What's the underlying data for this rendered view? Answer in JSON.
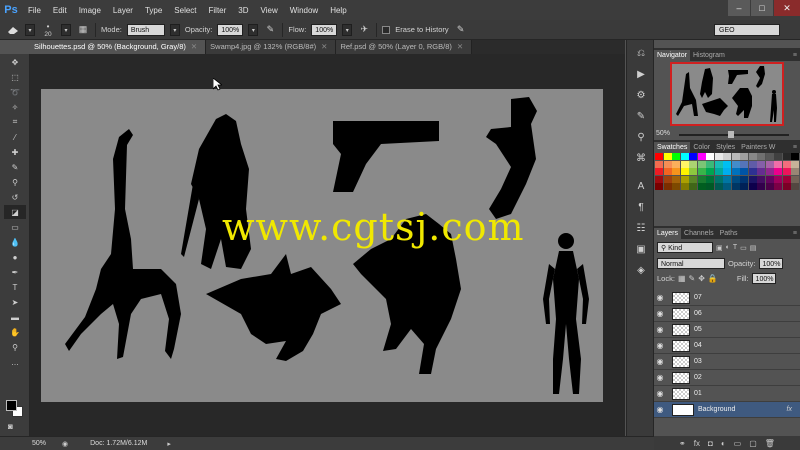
{
  "app": {
    "logo": "Ps"
  },
  "menu": [
    "File",
    "Edit",
    "Image",
    "Layer",
    "Type",
    "Select",
    "Filter",
    "3D",
    "View",
    "Window",
    "Help"
  ],
  "window_controls": [
    "–",
    "□",
    "✕"
  ],
  "options": {
    "brush_size": "20",
    "mode_label": "Mode:",
    "mode_value": "Brush",
    "opacity_label": "Opacity:",
    "opacity_value": "100%",
    "flow_label": "Flow:",
    "flow_value": "100%",
    "erase_history": "Erase to History",
    "workspace": "GEO"
  },
  "doc_tabs": [
    {
      "label": "Silhouettes.psd @ 50% (Background, Gray/8)"
    },
    {
      "label": "Swamp4.jpg @ 132% (RGB/8#)"
    },
    {
      "label": "Ref.psd @ 50% (Layer 0, RGB/8)"
    }
  ],
  "watermark": "www.cgtsj.com",
  "status": {
    "zoom": "50%",
    "doc": "Doc: 1.72M/6.12M"
  },
  "navigator": {
    "tabs": [
      "Navigator",
      "Histogram"
    ],
    "zoom": "50%"
  },
  "swatches": {
    "tabs": [
      "Swatches",
      "Color",
      "Styles",
      "Painters W"
    ],
    "colors": [
      "#ff0000",
      "#ffff00",
      "#00ff00",
      "#00ffff",
      "#0000ff",
      "#ff00ff",
      "#ffffff",
      "#e8e8e8",
      "#d0d0d0",
      "#b8b8b8",
      "#a0a0a0",
      "#888888",
      "#707070",
      "#585858",
      "#404040",
      "#282828",
      "#000000",
      "#f26c4f",
      "#f68e55",
      "#fbaf5c",
      "#fff467",
      "#acd372",
      "#7cc576",
      "#3bb878",
      "#1abbb4",
      "#00bff3",
      "#438cca",
      "#5574b9",
      "#605ca8",
      "#855fa8",
      "#a763a8",
      "#f06ea9",
      "#f26d7d",
      "#c7b299",
      "#ed1c24",
      "#f26522",
      "#f7941d",
      "#fff200",
      "#8dc73f",
      "#39b54a",
      "#00a651",
      "#00a99d",
      "#00aeef",
      "#0072bc",
      "#0054a6",
      "#2e3192",
      "#662d91",
      "#92278f",
      "#ec008c",
      "#ed145b",
      "#998675",
      "#9e0b0f",
      "#a0410d",
      "#a36209",
      "#aba000",
      "#598527",
      "#197b30",
      "#007236",
      "#00746b",
      "#0076a3",
      "#004b80",
      "#003471",
      "#1b1464",
      "#440e62",
      "#630460",
      "#9e005d",
      "#9e0039",
      "#736357",
      "#790000",
      "#7b2e00",
      "#7d4900",
      "#827b00",
      "#406618",
      "#005e20",
      "#005826",
      "#005952",
      "#005b7f",
      "#003663",
      "#002157",
      "#0d004c",
      "#32004b",
      "#4b0049",
      "#7b0046",
      "#7a0026",
      "#534741"
    ]
  },
  "layers": {
    "tabs": [
      "Layers",
      "Channels",
      "Paths"
    ],
    "kind": "Kind",
    "blend": "Normal",
    "opacity_label": "Opacity:",
    "opacity_value": "100%",
    "lock_label": "Lock:",
    "fill_label": "Fill:",
    "fill_value": "100%",
    "items": [
      {
        "name": "07"
      },
      {
        "name": "06"
      },
      {
        "name": "05"
      },
      {
        "name": "04"
      },
      {
        "name": "03"
      },
      {
        "name": "02"
      },
      {
        "name": "01"
      },
      {
        "name": "Background"
      }
    ],
    "fx": "fx"
  }
}
